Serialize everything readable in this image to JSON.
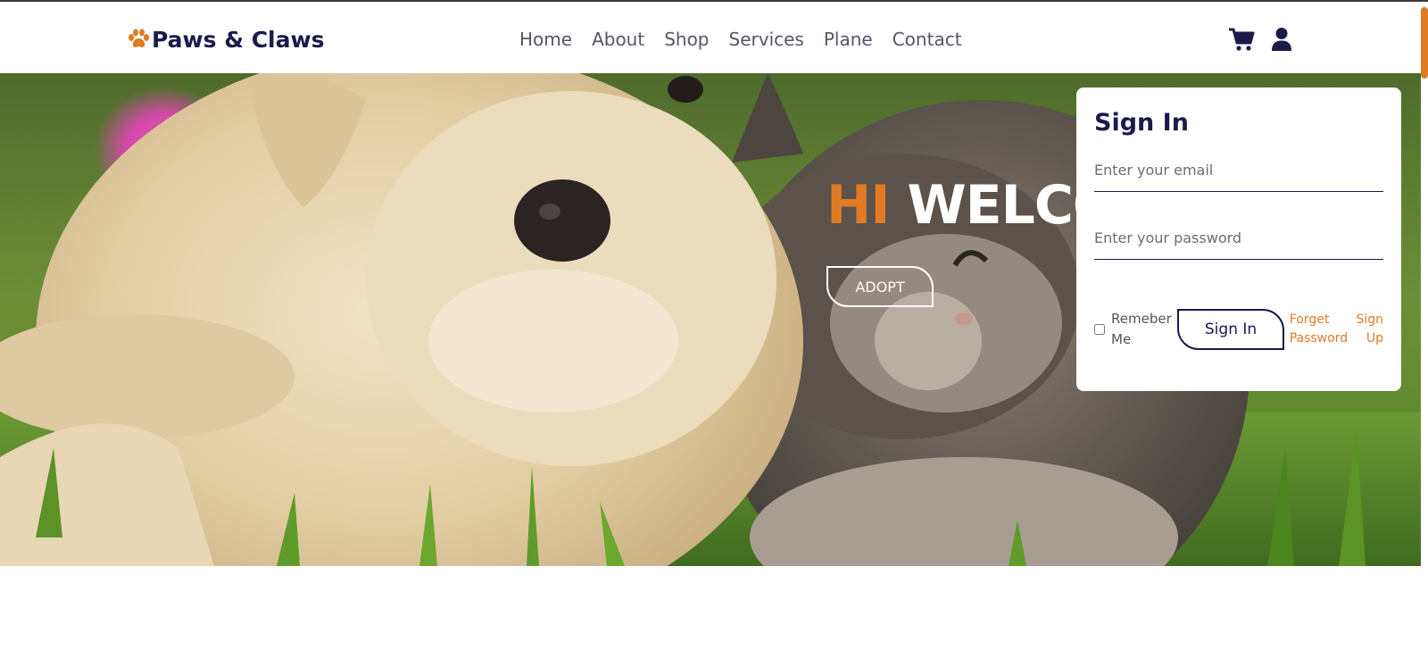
{
  "brand": {
    "name": "Paws & Claws",
    "accent_color": "#e07b24",
    "primary_color": "#1b1a4a"
  },
  "nav": {
    "items": [
      "Home",
      "About",
      "Shop",
      "Services",
      "Plane",
      "Contact"
    ],
    "icons": [
      "cart-icon",
      "user-icon"
    ]
  },
  "hero": {
    "title_hi": "HI",
    "title_rest": "WELCOME",
    "adopt_label": "ADOPT"
  },
  "signin": {
    "title": "Sign In",
    "email_placeholder": "Enter your email",
    "password_placeholder": "Enter your password",
    "remember_label": "Remeber Me",
    "button_label": "Sign In",
    "forgot_label": "Forget Password",
    "signup_label": "Sign Up"
  }
}
